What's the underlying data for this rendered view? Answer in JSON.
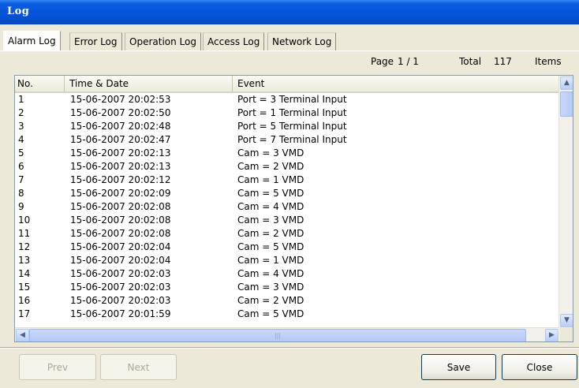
{
  "window": {
    "title": "Log"
  },
  "tabs": [
    {
      "label": "Alarm Log",
      "active": true
    },
    {
      "label": "Error Log",
      "active": false
    },
    {
      "label": "Operation Log",
      "active": false
    },
    {
      "label": "Access Log",
      "active": false
    },
    {
      "label": "Network Log",
      "active": false
    }
  ],
  "pager": {
    "page_label": "Page",
    "page_value": "1 / 1",
    "total_label": "Total",
    "total_value": "117",
    "items_label": "Items"
  },
  "table": {
    "columns": [
      "No.",
      "Time & Date",
      "Event"
    ],
    "rows": [
      [
        "1",
        "15-06-2007 20:02:53",
        "Port = 3 Terminal Input"
      ],
      [
        "2",
        "15-06-2007 20:02:50",
        "Port = 1 Terminal Input"
      ],
      [
        "3",
        "15-06-2007 20:02:48",
        "Port = 5 Terminal Input"
      ],
      [
        "4",
        "15-06-2007 20:02:47",
        "Port = 7 Terminal Input"
      ],
      [
        "5",
        "15-06-2007 20:02:13",
        "Cam = 3 VMD"
      ],
      [
        "6",
        "15-06-2007 20:02:13",
        "Cam = 2 VMD"
      ],
      [
        "7",
        "15-06-2007 20:02:12",
        "Cam = 1 VMD"
      ],
      [
        "8",
        "15-06-2007 20:02:09",
        "Cam = 5 VMD"
      ],
      [
        "9",
        "15-06-2007 20:02:08",
        "Cam = 4 VMD"
      ],
      [
        "10",
        "15-06-2007 20:02:08",
        "Cam = 3 VMD"
      ],
      [
        "11",
        "15-06-2007 20:02:08",
        "Cam = 2 VMD"
      ],
      [
        "12",
        "15-06-2007 20:02:04",
        "Cam = 5 VMD"
      ],
      [
        "13",
        "15-06-2007 20:02:04",
        "Cam = 1 VMD"
      ],
      [
        "14",
        "15-06-2007 20:02:03",
        "Cam = 4 VMD"
      ],
      [
        "15",
        "15-06-2007 20:02:03",
        "Cam = 3 VMD"
      ],
      [
        "16",
        "15-06-2007 20:02:03",
        "Cam = 2 VMD"
      ],
      [
        "17",
        "15-06-2007 20:01:59",
        "Cam = 5 VMD"
      ]
    ]
  },
  "icons": {
    "scroll_up": "chevron-up-icon",
    "scroll_down": "chevron-down-icon",
    "scroll_left": "chevron-left-icon",
    "scroll_right": "chevron-right-icon"
  },
  "buttons": {
    "prev": {
      "label": "Prev",
      "enabled": false
    },
    "next": {
      "label": "Next",
      "enabled": false
    },
    "save": {
      "label": "Save",
      "enabled": true
    },
    "close": {
      "label": "Close",
      "enabled": true
    }
  },
  "colors": {
    "titlebar": "#0553d8",
    "window_bg": "#ece9d8",
    "list_border": "#7f9db9"
  }
}
